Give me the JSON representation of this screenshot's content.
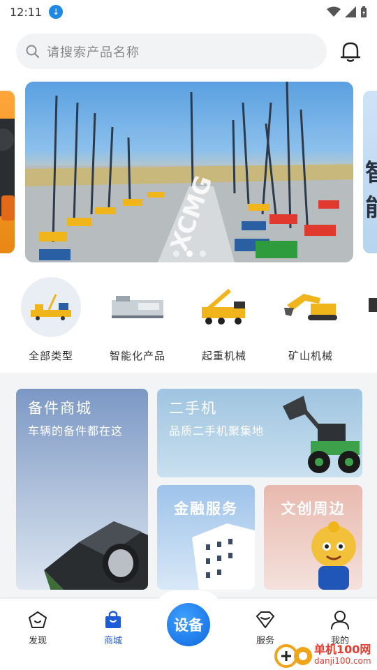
{
  "status_bar": {
    "time": "12:11"
  },
  "search": {
    "placeholder": "请搜索产品名称"
  },
  "banner": {
    "slide_count": 3,
    "active_slide": 2
  },
  "banner_right_peek": {
    "chars": [
      "智",
      "能"
    ]
  },
  "categories": [
    {
      "label": "全部类型",
      "active": true
    },
    {
      "label": "智能化产品",
      "active": false
    },
    {
      "label": "起重机械",
      "active": false
    },
    {
      "label": "矿山机械",
      "active": false
    }
  ],
  "tiles": {
    "parts": {
      "title": "备件商城",
      "subtitle": "车辆的备件都在这"
    },
    "used": {
      "title": "二手机",
      "subtitle": "品质二手机聚集地"
    },
    "finance": {
      "title": "金融服务"
    },
    "culture": {
      "title": "文创周边"
    }
  },
  "tabbar": {
    "discover": "发现",
    "mall": "商城",
    "center": "设备",
    "service": "服务",
    "mine": "我的",
    "active": "mall"
  },
  "watermark": {
    "line1": "单机100网",
    "line2": "danji100.com"
  },
  "colors": {
    "accent": "#1d5bd8",
    "fab": "#1a7ef0",
    "watermark": "#e63b2e"
  }
}
